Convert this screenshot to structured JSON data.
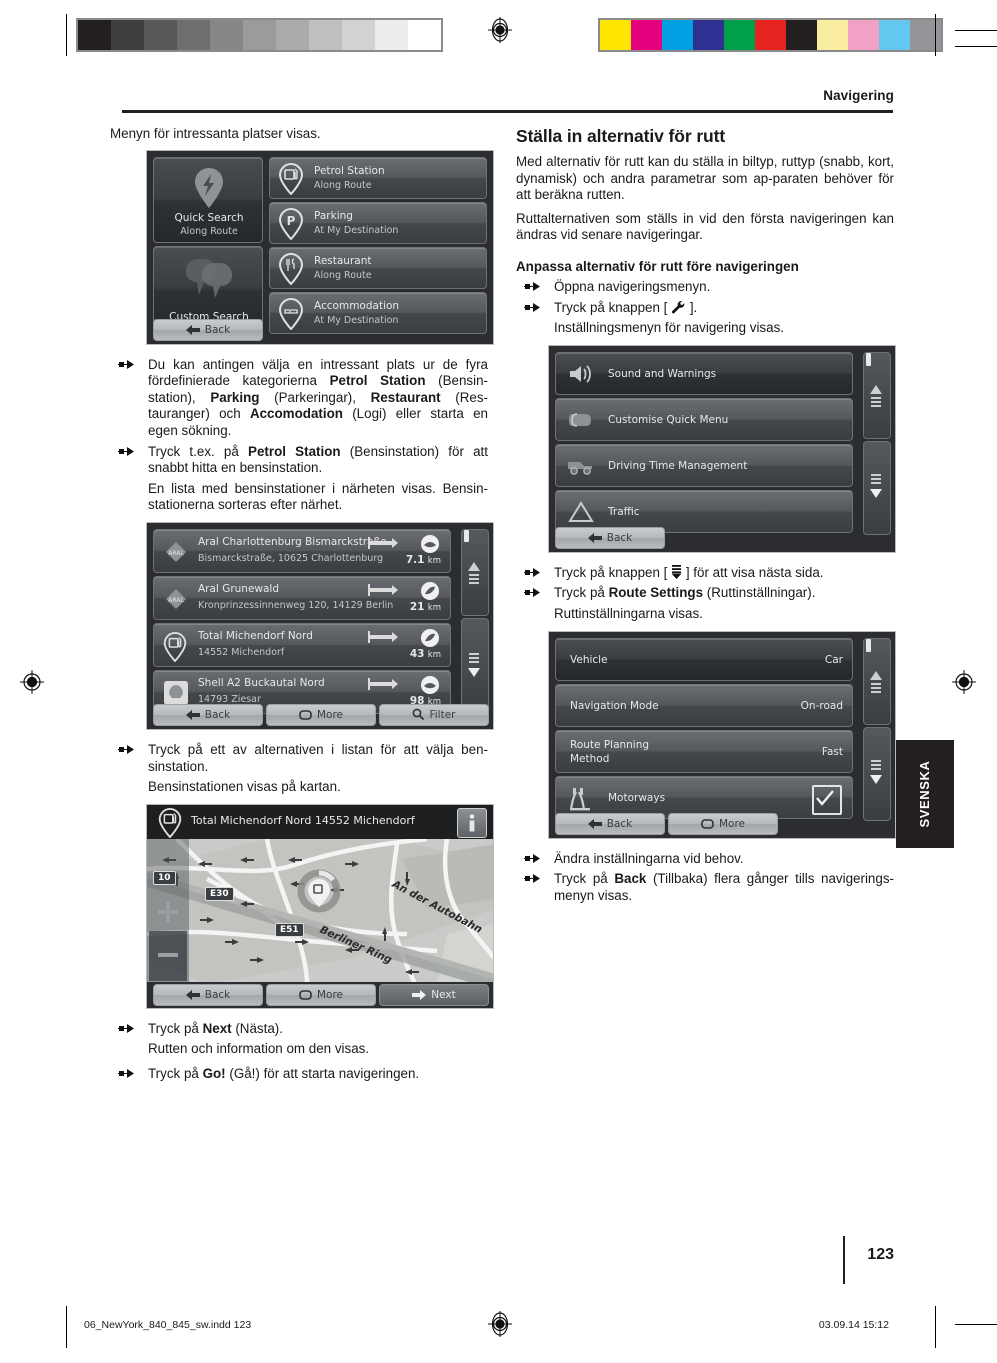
{
  "header": {
    "chapter": "Navigering",
    "language_tab": "SVENSKA",
    "page_number": "123"
  },
  "footer": {
    "file": "06_NewYork_840_845_sw.indd   123",
    "timestamp": "03.09.14   15:12"
  },
  "calibration": {
    "grayscale": [
      "#231f20",
      "#3f3f3f",
      "#585858",
      "#6e6e6e",
      "#878787",
      "#9b9b9b",
      "#ababab",
      "#bfbfbf",
      "#d2d2d2",
      "#ececec",
      "#ffffff"
    ],
    "colors": [
      "#ffe600",
      "#e5007d",
      "#00a0e3",
      "#2e3192",
      "#00a04a",
      "#e52421",
      "#231f20",
      "#faeda0",
      "#f2a0c3",
      "#64c7f0",
      "#939598"
    ]
  },
  "left_column": {
    "intro": "Menyn för intressanta platser visas.",
    "poi_screenshot": {
      "quick_search": {
        "label": "Quick Search",
        "sublabel": "Along Route",
        "icon": "flash-pin-icon"
      },
      "custom_search": {
        "label": "Custom Search",
        "icon": "clouds-icon"
      },
      "items": [
        {
          "label": "Petrol Station",
          "sublabel": "Along Route",
          "icon": "petrol-pin-icon"
        },
        {
          "label": "Parking",
          "sublabel": "At My Destination",
          "icon": "parking-pin-icon"
        },
        {
          "label": "Restaurant",
          "sublabel": "Along Route",
          "icon": "restaurant-pin-icon"
        },
        {
          "label": "Accommodation",
          "sublabel": "At My Destination",
          "icon": "bed-pin-icon"
        }
      ],
      "back": "Back"
    },
    "bullet1": {
      "p1": "Du kan antingen välja en intressant plats ur de fyra fördefinierade kategorierna ",
      "b1": "Petrol Station",
      "p2": " (Bensin-station), ",
      "b2": "Parking",
      "p3": " (Parkeringar), ",
      "b3": "Restaurant",
      "p4": " (Res-tauranger) och ",
      "b4": "Accomodation",
      "p5": " (Logi) eller starta en egen sökning."
    },
    "bullet2": {
      "p1": "Tryck t.ex. på ",
      "b1": "Petrol Station",
      "p2": " (Bensinstation) för att snabbt hitta en bensinstation."
    },
    "note1": "En lista med bensinstationer i närheten visas. Bensin-stationerna sorteras efter närhet.",
    "list_screenshot": {
      "rows": [
        {
          "name": "Aral Charlottenburg Bismarckstraße",
          "address": "Bismarckstraße, 10625 Charlottenburg",
          "distance": "7.1",
          "unit": "km",
          "brand": "aral-icon"
        },
        {
          "name": "Aral Grunewald",
          "address": "Kronprinzessinnenweg 120, 14129 Berlin",
          "distance": "21",
          "unit": "km",
          "brand": "aral-icon"
        },
        {
          "name": "Total Michendorf Nord",
          "address": "14552 Michendorf",
          "distance": "43",
          "unit": "km",
          "brand": "petrol-pin-icon"
        },
        {
          "name": "Shell A2 Buckautal Nord",
          "address": "14793 Ziesar",
          "distance": "98",
          "unit": "km",
          "brand": "shell-icon"
        }
      ],
      "buttons": [
        "Back",
        "More",
        "Filter"
      ]
    },
    "bullet3": "Tryck på ett av alternativen i listan för att välja ben-sinstation.",
    "note2": "Bensinstationen visas på kartan.",
    "map_screenshot": {
      "title": "Total Michendorf Nord 14552 Michendorf",
      "shields": [
        "10",
        "E30",
        "E51"
      ],
      "street_labels": [
        "An der Autobahn",
        "Berliner Ring"
      ],
      "buttons": [
        "Back",
        "More",
        "Next"
      ]
    },
    "bullet4": {
      "p1": "Tryck på ",
      "b1": "Next",
      "p2": " (Nästa)."
    },
    "note3": "Rutten och information om den visas.",
    "bullet5": {
      "p1": "Tryck på ",
      "b1": "Go!",
      "p2": " (Gå!) för att starta navigeringen."
    }
  },
  "right_column": {
    "heading": "Ställa in alternativ för rutt",
    "para1": "Med alternativ för rutt kan du ställa in biltyp, ruttyp (snabb, kort, dynamisk) och andra parametrar som ap-paraten behöver för att beräkna rutten.",
    "para2": "Ruttalternativen som ställs in vid den första navigeringen kan ändras vid senare navigeringar.",
    "subheading": "Anpassa alternativ för rutt före navigeringen",
    "bullet1": "Öppna navigeringsmenyn.",
    "bullet2": {
      "p1": "Tryck på knappen [ ",
      "icon": "wrench-icon",
      "p2": " ]."
    },
    "note1": "Inställningsmenyn för navigering visas.",
    "settings_screenshot": {
      "items": [
        {
          "label": "Sound and Warnings",
          "icon": "speaker-icon"
        },
        {
          "label": "Customise Quick Menu",
          "icon": "quickmenu-icon"
        },
        {
          "label": "Driving Time Management",
          "icon": "truck-icon"
        },
        {
          "label": "Traffic",
          "icon": "triangle-icon"
        }
      ],
      "back": "Back"
    },
    "bullet3": {
      "p1": "Tryck på knappen [ ",
      "icon": "next-page-icon",
      "p2": " ] för att visa nästa sida."
    },
    "bullet4": {
      "p1": "Tryck på ",
      "b1": "Route Settings",
      "p2": " (Ruttinställningar)."
    },
    "note2": "Ruttinställningarna visas.",
    "route_screenshot": {
      "rows": [
        {
          "label": "Vehicle",
          "value": "Car",
          "icon": ""
        },
        {
          "label": "Navigation Mode",
          "value": "On-road",
          "icon": ""
        },
        {
          "label": "Route Planning Method",
          "label_line1": "Route Planning",
          "label_line2": "Method",
          "value": "Fast",
          "icon": ""
        },
        {
          "label": "Motorways",
          "value": "checked",
          "icon": "motorway-icon"
        }
      ],
      "buttons": [
        "Back",
        "More"
      ]
    },
    "bullet5": "Ändra inställningarna vid behov.",
    "bullet6": {
      "p1": "Tryck på ",
      "b1": "Back",
      "p2": " (Tillbaka) flera gånger tills navigerings-menyn visas."
    }
  }
}
